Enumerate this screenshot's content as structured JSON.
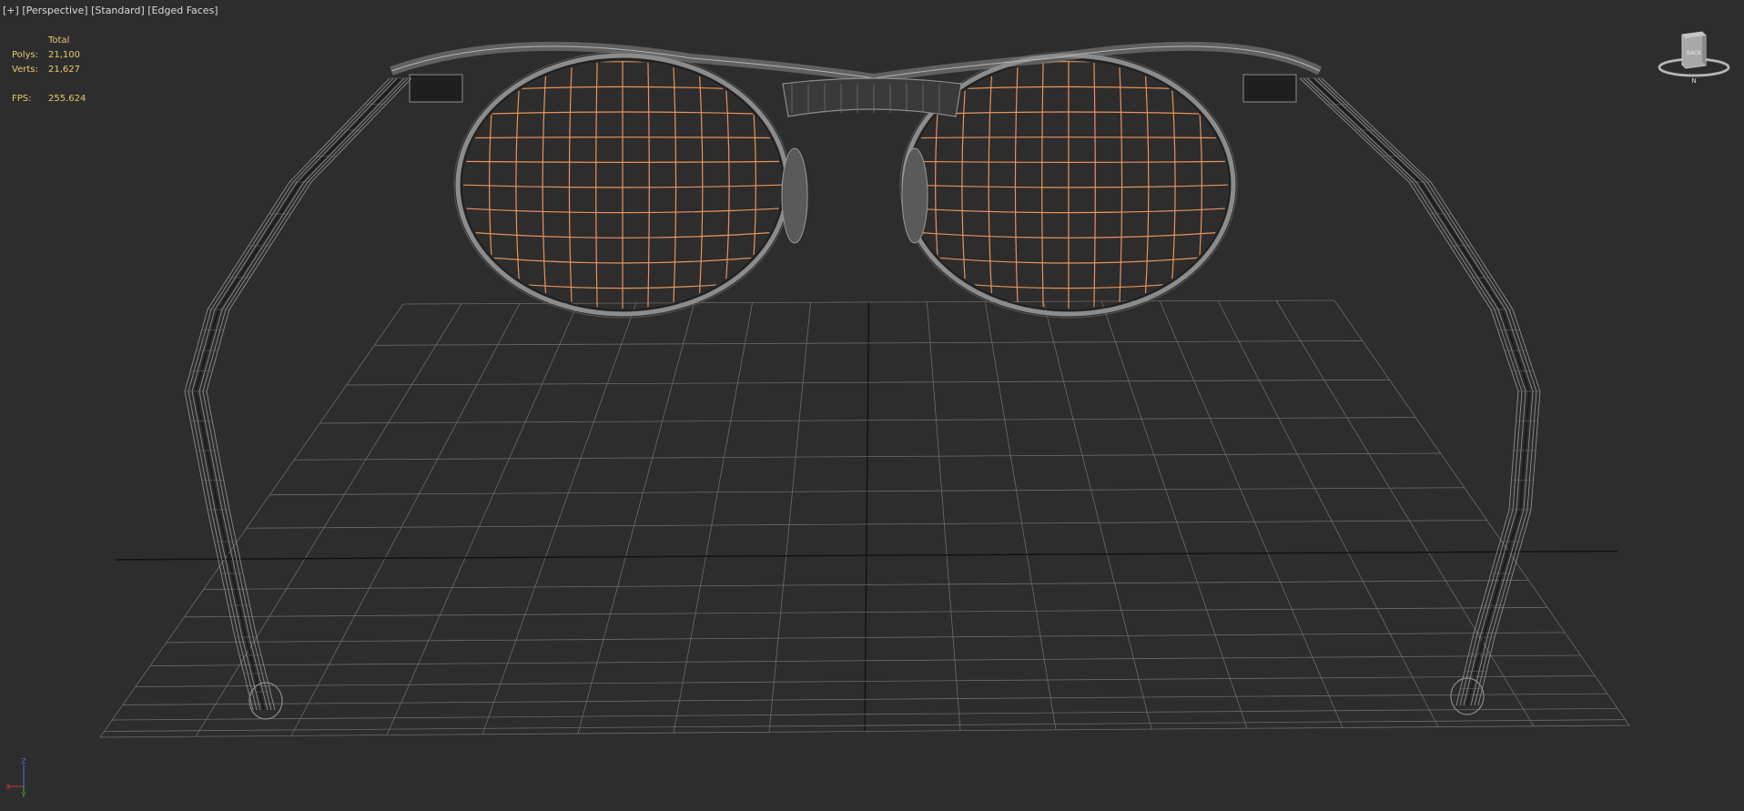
{
  "viewport": {
    "label_plus": "[+]",
    "label_view": "[Perspective]",
    "label_shading": "[Standard]",
    "label_edges": "[Edged Faces]"
  },
  "stats": {
    "header": "Total",
    "polys_label": "Polys:",
    "polys_value": "21,100",
    "verts_label": "Verts:",
    "verts_value": "21,627",
    "fps_label": "FPS:",
    "fps_value": "255.624"
  },
  "viewcube": {
    "face_label": "BACK",
    "compass_label": "N"
  },
  "axis_tripod": {
    "z_label": "Z",
    "x_label": "X",
    "y_label": "Y"
  },
  "colors": {
    "background": "#2d2d2d",
    "grid": "#6b6b6b",
    "grid_axis": "#111111",
    "wireframe": "#8c8c8c",
    "lens_wire": "#e8935a",
    "stats_text": "#e6c86e",
    "label_text": "#d8d8d8"
  },
  "icons": {
    "viewcube": "viewcube-icon",
    "tripod": "axis-tripod-icon"
  }
}
